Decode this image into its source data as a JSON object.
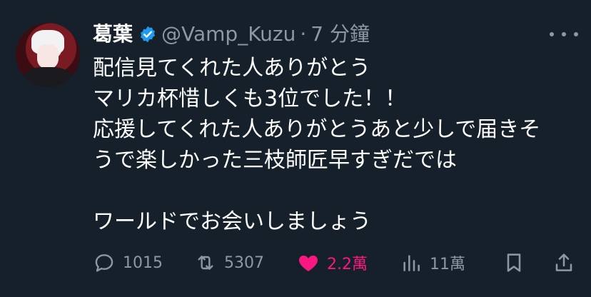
{
  "tweet": {
    "display_name": "葛葉",
    "handle": "@Vamp_Kuzu",
    "separator": "·",
    "time": "7 分鐘",
    "lines": [
      "配信見てくれた人ありがとう",
      "マリカ杯惜しくも3位でした！！",
      "応援してくれた人ありがとうあと少しで届きそ",
      "うで楽しかった三枝師匠早すぎだでは",
      "",
      "ワールドでお会いしましょう"
    ]
  },
  "actions": {
    "replies": "1015",
    "retweets": "5307",
    "likes": "2.2萬",
    "views": "11萬"
  },
  "icons": {
    "verified": "verified-badge-icon",
    "more": "more-icon",
    "reply": "reply-icon",
    "retweet": "retweet-icon",
    "like": "heart-icon",
    "views": "views-icon",
    "bookmark": "bookmark-icon",
    "share": "share-icon"
  },
  "colors": {
    "background": "#15202b",
    "text": "#ffffff",
    "muted": "#8b98a5",
    "verified": "#1d9bf0",
    "like": "#f91880"
  }
}
